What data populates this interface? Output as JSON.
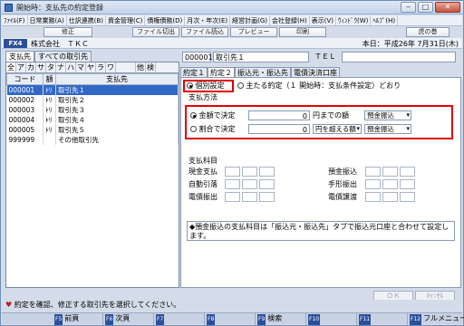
{
  "window": {
    "title": "開始時：支払先の約定登録"
  },
  "menu": [
    "ﾌｧｲﾙ(F)",
    "日常業務(A)",
    "仕訳連携(B)",
    "資金管理(C)",
    "債権債務(D)",
    "月次・年次(E)",
    "経営計画(G)",
    "会社登録(H)",
    "表示(V)",
    "ｳｨﾝﾄﾞｳ(W)",
    "ﾍﾙﾌﾟ(H)"
  ],
  "toolbar": {
    "fix": "修正",
    "file_out": "ファイル切出",
    "file_in": "ファイル読込",
    "preview": "プレビュー",
    "print": "印刷",
    "tora": "虎の巻"
  },
  "company": {
    "badge": "FX4",
    "name": "株式会社　ＴＫＣ",
    "date": "本日：平成26年 7月31日(木)"
  },
  "left": {
    "tabs": [
      "支払先",
      "すべての取引先"
    ],
    "kana": [
      "全",
      "ア",
      "カ",
      "サ",
      "タ",
      "ナ",
      "ハ",
      "マ",
      "ヤ",
      "ラ",
      "ワ",
      "",
      "他",
      "検"
    ],
    "headers": [
      "コード",
      "額",
      "支払先"
    ],
    "rows": [
      {
        "code": "000001",
        "kind": "ﾄﾘ",
        "name": "取引先１"
      },
      {
        "code": "000002",
        "kind": "ﾄﾘ",
        "name": "取引先２"
      },
      {
        "code": "000003",
        "kind": "ﾄﾘ",
        "name": "取引先３"
      },
      {
        "code": "000004",
        "kind": "ﾄﾘ",
        "name": "取引先４"
      },
      {
        "code": "000005",
        "kind": "ﾄﾘ",
        "name": "取引先５"
      },
      {
        "code": "999999",
        "kind": "",
        "name": "その他取引先"
      }
    ]
  },
  "right": {
    "code": "000001",
    "name": "取引先１",
    "tel_label": "ＴＥＬ",
    "tel": "",
    "tabs": [
      "約定１",
      "約定２",
      "振込元・振込先",
      "電債決済口座"
    ],
    "mode_individual": "個別設定",
    "mode_main": "主たる約定（１ 開始時：支払条件設定）どおり",
    "method_title": "支払方法",
    "fixed_label": "金額で決定",
    "fixed_value": "0",
    "fixed_suffix": "円までの額",
    "fixed_method": "預金振込",
    "ratio_label": "割合で決定",
    "ratio_value": "0",
    "ratio_cond": "円を超える額",
    "ratio_method": "預金振込",
    "subject_title": "支払科目",
    "subjects": [
      "現金支払",
      "預金振込",
      "自動引落",
      "手形振出",
      "電債振出",
      "電債譲渡"
    ],
    "note": "◆預金振込の支払科目は「振込元・振込先」タブで振込元口座と合わせて設定します。",
    "ok": "ＯＫ",
    "cancel": "ｷｬﾝｾﾙ"
  },
  "status_text": "約定を確認、修正する取引先を選択してください。",
  "fkeys": [
    {
      "key": "F5",
      "label": "前頁"
    },
    {
      "key": "F6",
      "label": "次頁"
    },
    {
      "key": "F7",
      "label": ""
    },
    {
      "key": "F8",
      "label": ""
    },
    {
      "key": "F9",
      "label": "検索"
    },
    {
      "key": "F10",
      "label": ""
    },
    {
      "key": "F11",
      "label": ""
    },
    {
      "key": "F12",
      "label": "フルメニュー"
    }
  ]
}
